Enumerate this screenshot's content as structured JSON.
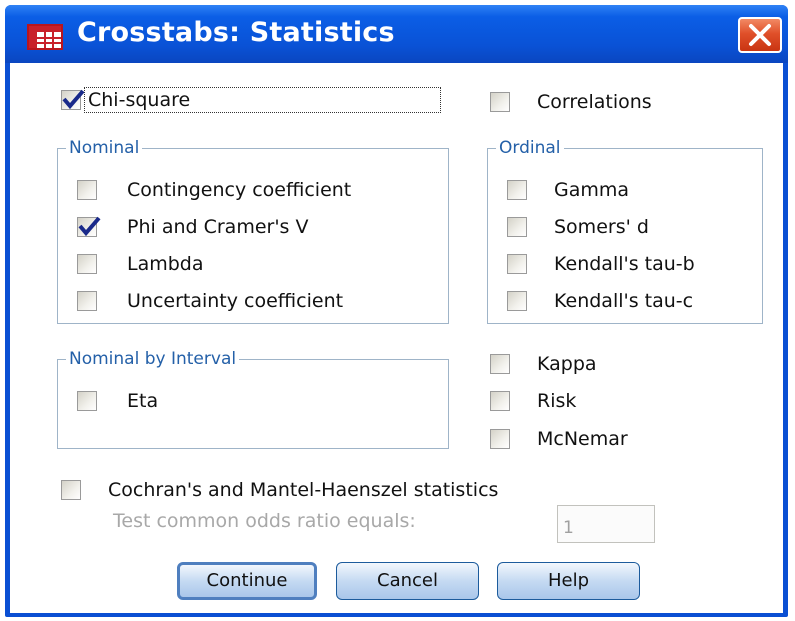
{
  "window": {
    "title": "Crosstabs: Statistics",
    "icon": "spss-grid-icon",
    "close_icon": "close-icon"
  },
  "chi_square": {
    "label": "Chi-square",
    "checked": true
  },
  "correlations": {
    "label": "Correlations",
    "checked": false
  },
  "nominal": {
    "legend": "Nominal",
    "items": [
      {
        "label": "Contingency coefficient",
        "checked": false
      },
      {
        "label": "Phi and Cramer's V",
        "checked": true
      },
      {
        "label": "Lambda",
        "checked": false
      },
      {
        "label": "Uncertainty coefficient",
        "checked": false
      }
    ]
  },
  "ordinal": {
    "legend": "Ordinal",
    "items": [
      {
        "label": "Gamma",
        "checked": false
      },
      {
        "label": "Somers' d",
        "checked": false
      },
      {
        "label": "Kendall's tau-b",
        "checked": false
      },
      {
        "label": "Kendall's tau-c",
        "checked": false
      }
    ]
  },
  "nominal_by_interval": {
    "legend": "Nominal by Interval",
    "items": [
      {
        "label": "Eta",
        "checked": false
      }
    ]
  },
  "extra": [
    {
      "label": "Kappa",
      "checked": false
    },
    {
      "label": "Risk",
      "checked": false
    },
    {
      "label": "McNemar",
      "checked": false
    }
  ],
  "cmh": {
    "label": "Cochran's and Mantel-Haenszel statistics",
    "checked": false
  },
  "odds": {
    "label": "Test common odds ratio equals:",
    "value": "1",
    "enabled": false
  },
  "buttons": {
    "continue": "Continue",
    "cancel": "Cancel",
    "help": "Help"
  },
  "colors": {
    "titlebar": "#0a52d6",
    "legend_text": "#2460a8",
    "check": "#1a2a8a",
    "close": "#e0502a"
  }
}
